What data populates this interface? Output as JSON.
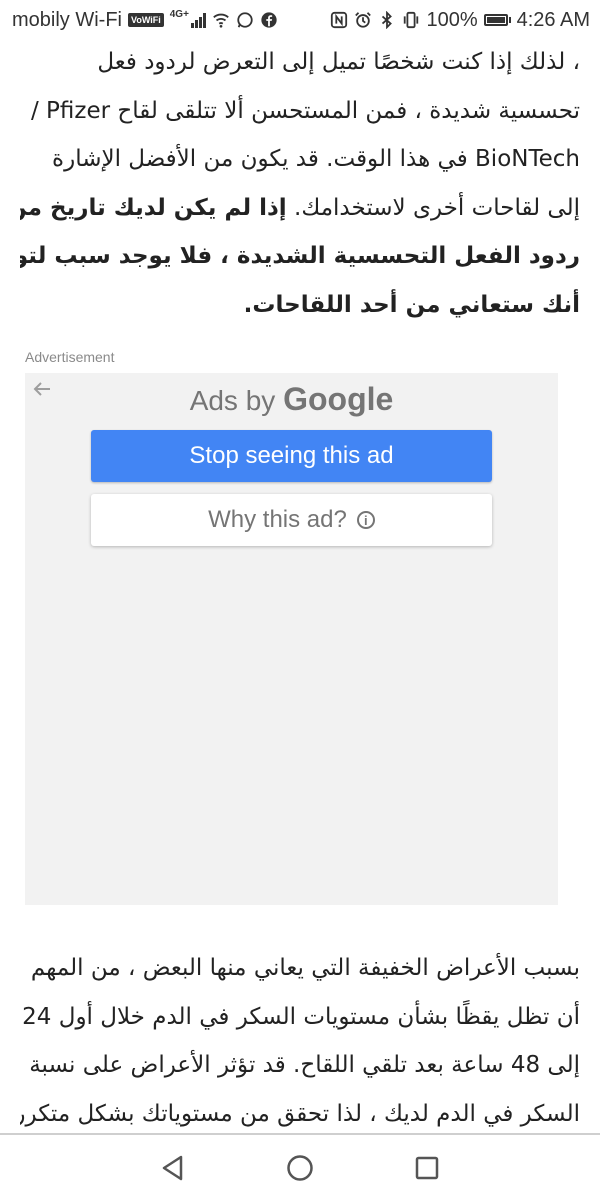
{
  "status_bar": {
    "carrier": "mobily Wi-Fi",
    "volte_badge": "VoWiFi",
    "network_type": "4G+",
    "battery_percent": "100%",
    "time": "4:26 AM",
    "icons": [
      "signal-icon",
      "wifi-icon",
      "whatsapp-icon",
      "facebook-icon",
      "nfc-icon",
      "alarm-icon",
      "bluetooth-icon",
      "vibrate-icon",
      "battery-icon"
    ]
  },
  "article_top": {
    "lines": [
      "، لذلك إذا كنت شخصًا تميل إلى التعرض لردود فعل",
      "تحسسية شديدة ، فمن المستحسن ألا تتلقى لقاح Pfizer /",
      "BioNTech في هذا الوقت. قد يكون من الأفضل الإشارة",
      "إلى لقاحات أخرى لاستخدامك."
    ],
    "bold_lines": [
      "إذا لم يكن لديك تاريخ من",
      "ردود الفعل التحسسية الشديدة ، فلا يوجد سبب لتوقع",
      "أنك ستعاني من أحد اللقاحات."
    ]
  },
  "ad": {
    "label": "Advertisement",
    "ads_by": "Ads by",
    "brand": "Google",
    "stop_label": "Stop seeing this ad",
    "why_label": "Why this ad?"
  },
  "article_bottom": {
    "lines": [
      "بسبب الأعراض الخفيفة التي يعاني منها البعض ، من المهم",
      "أن تظل يقظًا بشأن مستويات السكر في الدم خلال أول 24",
      "إلى 48 ساعة بعد تلقي اللقاح. قد تؤثر الأعراض على نسبة",
      "السكر في الدم لديك ، لذا تحقق من مستوياتك بشكل متكرر"
    ]
  },
  "nav_bar": {
    "icons": [
      "back-icon",
      "home-icon",
      "recents-icon"
    ]
  }
}
